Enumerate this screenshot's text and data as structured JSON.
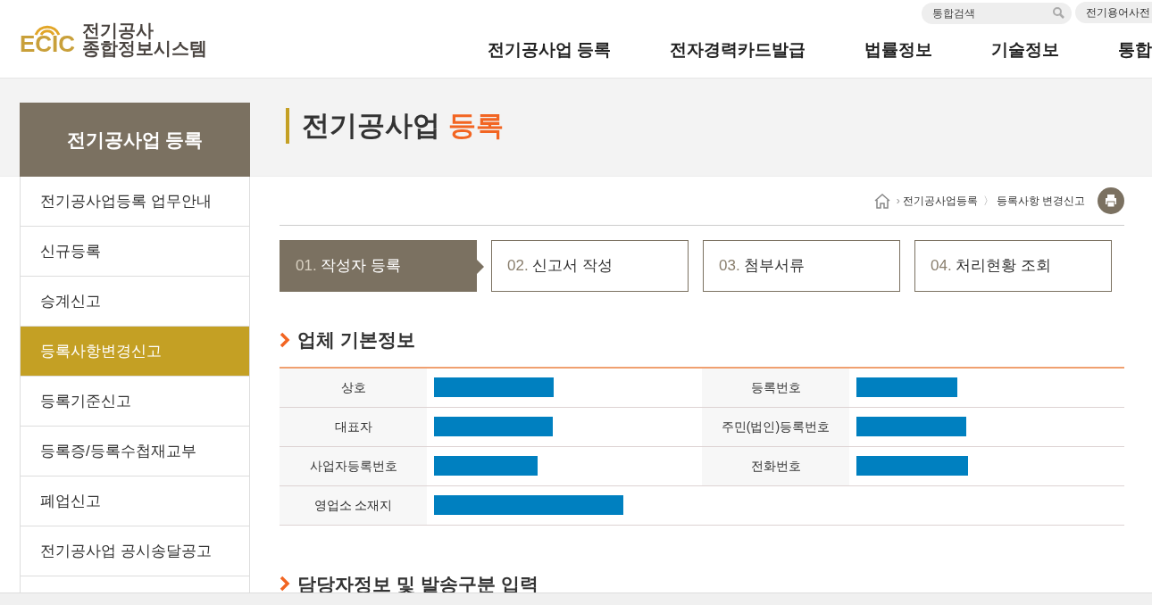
{
  "header": {
    "logo_mark": "ECIC",
    "logo_line1": "전기공사",
    "logo_line2": "종합정보시스템",
    "search": {
      "placeholder": "통합검색"
    },
    "dictionary_button": "전기용어사전",
    "nav": [
      "전기공사업 등록",
      "전자경력카드발급",
      "법률정보",
      "기술정보",
      "통합"
    ]
  },
  "sidebar": {
    "title": "전기공사업 등록",
    "items": [
      {
        "label": "전기공사업등록 업무안내",
        "selected": false
      },
      {
        "label": "신규등록",
        "selected": false
      },
      {
        "label": "승계신고",
        "selected": false
      },
      {
        "label": "등록사항변경신고",
        "selected": true
      },
      {
        "label": "등록기준신고",
        "selected": false
      },
      {
        "label": "등록증/등록수첩재교부",
        "selected": false
      },
      {
        "label": "폐업신고",
        "selected": false
      },
      {
        "label": "전기공사업 공시송달공고",
        "selected": false
      }
    ]
  },
  "page_title": {
    "main": "전기공사업",
    "accent": "등록"
  },
  "breadcrumb": [
    {
      "separator": "›",
      "label": "전기공사업등록"
    },
    {
      "separator": "〉",
      "label": "등록사항 변경신고"
    }
  ],
  "steps": [
    {
      "number": "01.",
      "label": "작성자 등록",
      "selected": true
    },
    {
      "number": "02.",
      "label": "신고서 작성",
      "selected": false
    },
    {
      "number": "03.",
      "label": "첨부서류",
      "selected": false
    },
    {
      "number": "04.",
      "label": "처리현황 조회",
      "selected": false
    }
  ],
  "section1": {
    "title": "업체 기본정보",
    "rows": [
      [
        {
          "label": "상호",
          "redacted": true
        },
        {
          "label": "등록번호",
          "redacted": true
        }
      ],
      [
        {
          "label": "대표자",
          "redacted": true
        },
        {
          "label": "주민(법인)등록번호",
          "redacted": true
        }
      ],
      [
        {
          "label": "사업자등록번호",
          "redacted": true
        },
        {
          "label": "전화번호",
          "redacted": true
        }
      ],
      [
        {
          "label": "영업소 소재지",
          "redacted": true
        }
      ]
    ]
  },
  "section2": {
    "title": "담당자정보 및 발송구분 입력"
  }
}
